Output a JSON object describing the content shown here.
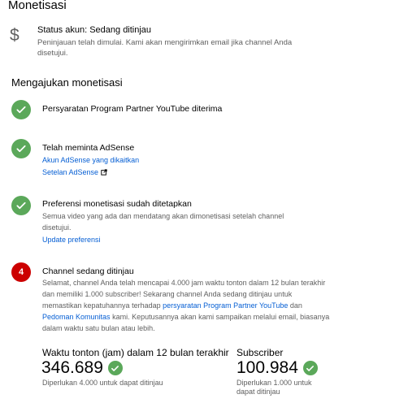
{
  "page": {
    "title": "Monetisasi"
  },
  "status": {
    "icon": "dollar-icon",
    "title": "Status akun: Sedang ditinjau",
    "description": "Peninjauan telah dimulai. Kami akan mengirimkan email jika channel Anda disetujui."
  },
  "section": {
    "title": "Mengajukan monetisasi"
  },
  "steps": [
    {
      "icon": "check-icon",
      "title": "Persyaratan Program Partner YouTube diterima"
    },
    {
      "icon": "check-icon",
      "title": "Telah meminta AdSense",
      "links": [
        "Akun AdSense yang dikaitkan",
        "Setelan AdSense"
      ]
    },
    {
      "icon": "check-icon",
      "title": "Preferensi monetisasi sudah ditetapkan",
      "text": "Semua video yang ada dan mendatang akan dimonetisasi setelah channel disetujui.",
      "link": "Update preferensi"
    },
    {
      "icon": "number-icon",
      "number": "4",
      "title": "Channel sedang ditinjau",
      "text_parts": [
        "Selamat, channel Anda telah mencapai 4.000 jam waktu tonton dalam 12 bulan terakhir dan memiliki 1.000 subscriber! Sekarang channel Anda sedang ditinjau untuk memastikan kepatuhannya terhadap ",
        "persyaratan Program Partner YouTube",
        " dan ",
        "Pedoman Komunitas",
        " kami. Keputusannya akan kami sampaikan melalui email, biasanya dalam waktu satu bulan atau lebih."
      ]
    }
  ],
  "metrics": [
    {
      "label": "Waktu tonton (jam) dalam 12 bulan terakhir",
      "value": "346.689",
      "note": "Diperlukan 4.000 untuk dapat ditinjau"
    },
    {
      "label": "Subscriber",
      "value": "100.984",
      "note": "Diperlukan 1.000 untuk dapat ditinjau"
    }
  ],
  "colors": {
    "success": "#5ba85a",
    "pending": "#cc0000",
    "link": "#065fd4",
    "secondary_text": "#606060"
  }
}
